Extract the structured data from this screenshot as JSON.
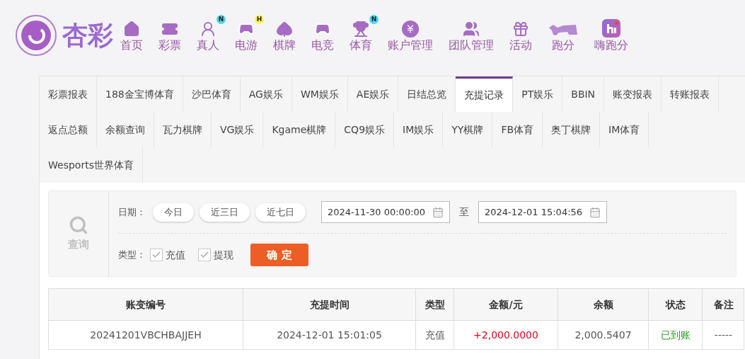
{
  "logo": {
    "text": "杏彩"
  },
  "nav": [
    {
      "label": "首页"
    },
    {
      "label": "彩票"
    },
    {
      "label": "真人",
      "badge": "N",
      "color": "#4fd6f0"
    },
    {
      "label": "电游",
      "badge": "H",
      "color": "#fff35a"
    },
    {
      "label": "棋牌"
    },
    {
      "label": "电竞"
    },
    {
      "label": "体育",
      "badge": "N",
      "color": "#4fd6f0"
    },
    {
      "label": "账户管理"
    },
    {
      "label": "团队管理"
    },
    {
      "label": "活动"
    },
    {
      "label": "跑分"
    },
    {
      "label": "嗨跑分"
    }
  ],
  "tab_rows": [
    {
      "tabs": [
        {
          "label": "彩票报表",
          "selected": false
        },
        {
          "label": "188金宝博体育",
          "selected": false
        },
        {
          "label": "沙巴体育",
          "selected": false
        },
        {
          "label": "AG娱乐",
          "selected": false
        },
        {
          "label": "WM娱乐",
          "selected": false
        },
        {
          "label": "AE娱乐",
          "selected": false
        },
        {
          "label": "日结总览",
          "selected": false
        },
        {
          "label": "充提记录",
          "selected": true
        },
        {
          "label": "PT娱乐",
          "selected": false
        },
        {
          "label": "BBIN",
          "selected": false
        },
        {
          "label": "账变报表",
          "selected": false
        },
        {
          "label": "转账报表",
          "selected": false
        }
      ]
    },
    {
      "tabs": [
        {
          "label": "返点总额",
          "selected": false
        },
        {
          "label": "余额查询",
          "selected": false
        },
        {
          "label": "瓦力棋牌",
          "selected": false
        },
        {
          "label": "VG娱乐",
          "selected": false
        },
        {
          "label": "Kgame棋牌",
          "selected": false
        },
        {
          "label": "CQ9娱乐",
          "selected": false
        },
        {
          "label": "IM娱乐",
          "selected": false
        },
        {
          "label": "YY棋牌",
          "selected": false
        },
        {
          "label": "FB体育",
          "selected": false
        },
        {
          "label": "奥丁棋牌",
          "selected": false
        },
        {
          "label": "IM体育",
          "selected": false
        }
      ]
    },
    {
      "tabs": [
        {
          "label": "Wesports世界体育",
          "selected": false
        }
      ]
    }
  ],
  "filter": {
    "search_label": "查询",
    "date_label": "日期：",
    "quick_dates": [
      "今日",
      "近三日",
      "近七日"
    ],
    "date_from": "2024-11-30 00:00:00",
    "separator": "至",
    "date_to": "2024-12-01 15:04:56",
    "type_label": "类型：",
    "types": [
      {
        "label": "充值",
        "checked": true
      },
      {
        "label": "提现",
        "checked": true
      }
    ],
    "submit": "确 定"
  },
  "table": {
    "columns": [
      "账变编号",
      "充提时间",
      "类型",
      "金额/元",
      "余额",
      "状态",
      "备注"
    ],
    "rows": [
      [
        {
          "kind": "text",
          "text": "20241201VBCHBAJJEH"
        },
        {
          "kind": "text",
          "text": "2024-12-01 15:01:05"
        },
        {
          "kind": "text",
          "text": "充值"
        },
        {
          "kind": "amount",
          "text": "+2,000.0000"
        },
        {
          "kind": "text",
          "text": "2,000.5407"
        },
        {
          "kind": "status",
          "text": "已到账"
        },
        {
          "kind": "text",
          "text": "-----"
        }
      ]
    ]
  }
}
